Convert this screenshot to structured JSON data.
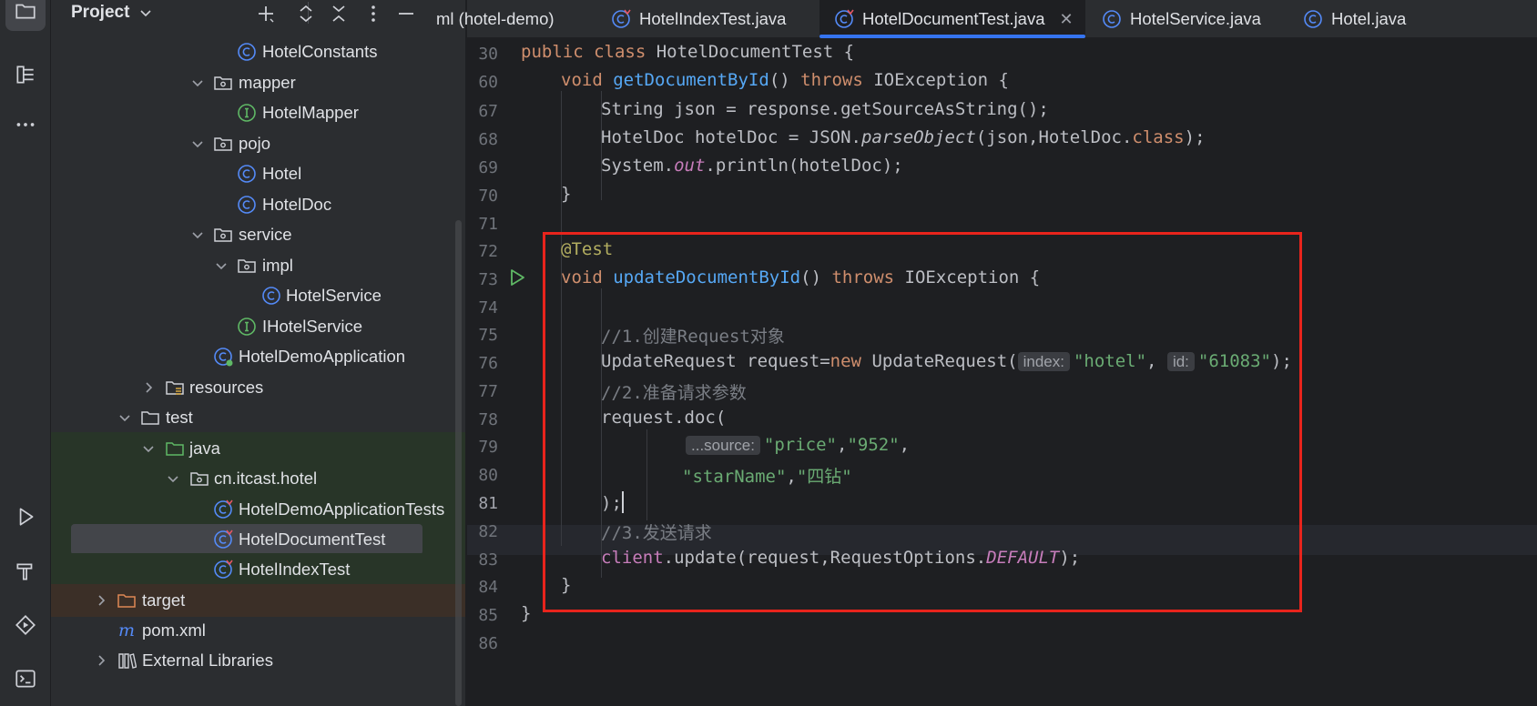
{
  "project_panel": {
    "title": "Project",
    "tree": [
      {
        "label": "HotelConstants",
        "icon": "class-icon"
      },
      {
        "label": "mapper",
        "icon": "package-icon"
      },
      {
        "label": "HotelMapper",
        "icon": "interface-icon"
      },
      {
        "label": "pojo",
        "icon": "package-icon"
      },
      {
        "label": "Hotel",
        "icon": "class-icon"
      },
      {
        "label": "HotelDoc",
        "icon": "class-icon"
      },
      {
        "label": "service",
        "icon": "package-icon"
      },
      {
        "label": "impl",
        "icon": "package-icon"
      },
      {
        "label": "HotelService",
        "icon": "class-icon"
      },
      {
        "label": "IHotelService",
        "icon": "interface-icon"
      },
      {
        "label": "HotelDemoApplication",
        "icon": "spring-class-icon"
      },
      {
        "label": "resources",
        "icon": "resources-folder-icon"
      },
      {
        "label": "test",
        "icon": "folder-icon"
      },
      {
        "label": "java",
        "icon": "test-source-folder-icon"
      },
      {
        "label": "cn.itcast.hotel",
        "icon": "package-icon"
      },
      {
        "label": "HotelDemoApplicationTests",
        "icon": "test-class-icon"
      },
      {
        "label": "HotelDocumentTest",
        "icon": "test-class-icon"
      },
      {
        "label": "HotelIndexTest",
        "icon": "test-class-icon"
      },
      {
        "label": "target",
        "icon": "excluded-folder-icon"
      },
      {
        "label": "pom.xml",
        "icon": "maven-icon"
      },
      {
        "label": "External Libraries",
        "icon": "library-icon"
      }
    ]
  },
  "tabs": [
    {
      "label": "ml (hotel-demo)",
      "icon": ""
    },
    {
      "label": "HotelIndexTest.java",
      "icon": "test-class-icon"
    },
    {
      "label": "HotelDocumentTest.java",
      "icon": "test-class-icon",
      "active": true
    },
    {
      "label": "HotelService.java",
      "icon": "class-icon"
    },
    {
      "label": "Hotel.java",
      "icon": "class-icon"
    }
  ],
  "editor": {
    "line_numbers": [
      "30",
      "60",
      "67",
      "68",
      "69",
      "70",
      "71",
      "72",
      "73",
      "74",
      "75",
      "76",
      "77",
      "78",
      "79",
      "80",
      "81",
      "82",
      "83",
      "84",
      "85",
      "86"
    ],
    "current_line": "81",
    "code": {
      "l30_public": "public",
      "l30_class": "class",
      "l30_rest": " HotelDocumentTest {",
      "l60_void": "void",
      "l60_fn": "getDocumentById",
      "l60_mid": "() ",
      "l60_throws": "throws",
      "l60_rest": " IOException {",
      "l67": "String json = response.getSourceAsString();",
      "l68_a": "HotelDoc hotelDoc = JSON.",
      "l68_b": "parseObject",
      "l68_c": "(json,HotelDoc.",
      "l68_d": "class",
      "l68_e": ");",
      "l69_a": "System.",
      "l69_b": "out",
      "l69_c": ".println(hotelDoc);",
      "l70": "}",
      "l72": "@Test",
      "l73_void": "void",
      "l73_fn": "updateDocumentById",
      "l73_mid": "() ",
      "l73_throws": "throws",
      "l73_rest": " IOException {",
      "l75": "//1.创建Request对象",
      "l76_a": "UpdateRequest request=",
      "l76_new": "new",
      "l76_b": " UpdateRequest(",
      "l76_hint1": "index:",
      "l76_s1": "\"hotel\"",
      "l76_comma": ",",
      "l76_hint2": "id:",
      "l76_s2": "\"61083\"",
      "l76_end": ");",
      "l77": "//2.准备请求参数",
      "l78": "request.doc(",
      "l79_hint": "...source:",
      "l79_s1": "\"price\"",
      "l79_c": ",",
      "l79_s2": "\"952\"",
      "l79_end": ",",
      "l80_s1": "\"starName\"",
      "l80_c": ",",
      "l80_s2": "\"四钻\"",
      "l81": ");",
      "l82": "//3.发送请求",
      "l83_a": "client",
      "l83_b": ".update(request,RequestOptions.",
      "l83_c": "DEFAULT",
      "l83_d": ");",
      "l84": "}",
      "l85": "}"
    }
  },
  "colors": {
    "highlight_box": "#e8241c",
    "keyword": "#cf8e6d",
    "function": "#56a8f5",
    "string": "#6aab73",
    "comment": "#7a7e85",
    "annotation": "#b3ae60"
  }
}
